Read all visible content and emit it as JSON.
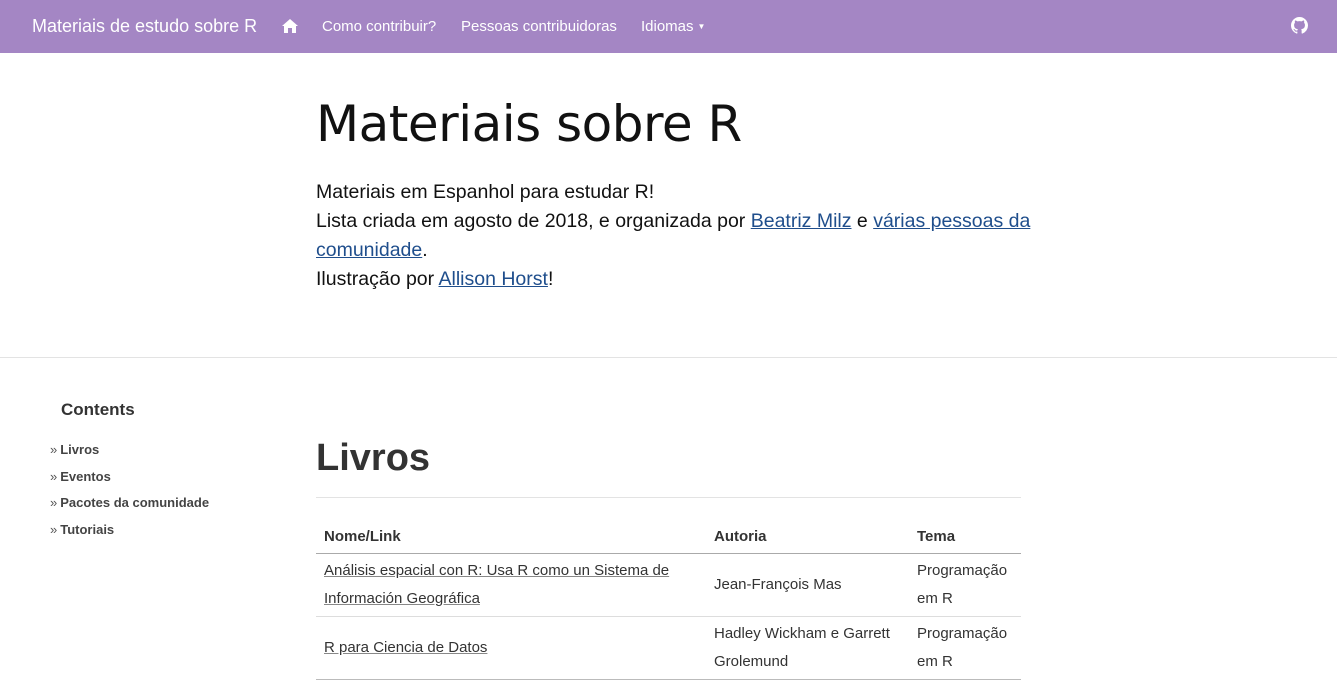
{
  "navbar": {
    "brand": "Materiais de estudo sobre R",
    "home_icon": "home-icon",
    "links": {
      "contribute": "Como contribuir?",
      "people": "Pessoas contribuidoras",
      "languages": "Idiomas"
    },
    "github_icon": "github-icon",
    "background": "#a486c4"
  },
  "hero": {
    "title": "Materiais sobre R",
    "line1": "Materiais em Espanhol para estudar R!",
    "line2_prefix": "Lista criada em agosto de 2018, e organizada por ",
    "line2_link1": "Beatriz Milz",
    "line2_mid": " e ",
    "line2_link2": "várias pessoas da comunidade",
    "line2_suffix": ".",
    "line3_prefix": "Ilustração por ",
    "line3_link": "Allison Horst",
    "line3_suffix": "!"
  },
  "sidebar": {
    "title": "Contents",
    "items": [
      {
        "label": "Livros"
      },
      {
        "label": "Eventos"
      },
      {
        "label": "Pacotes da comunidade"
      },
      {
        "label": "Tutoriais"
      }
    ]
  },
  "main": {
    "section_title": "Livros",
    "table": {
      "headers": [
        "Nome/Link",
        "Autoria",
        "Tema"
      ],
      "rows": [
        {
          "name": "Análisis espacial con R: Usa R como un Sistema de Información Geográfica",
          "author": "Jean-François Mas",
          "topic": "Programação em R"
        },
        {
          "name": "R para Ciencia de Datos",
          "author": "Hadley Wickham e Garrett Grolemund",
          "topic": "Programação em R"
        }
      ]
    }
  }
}
